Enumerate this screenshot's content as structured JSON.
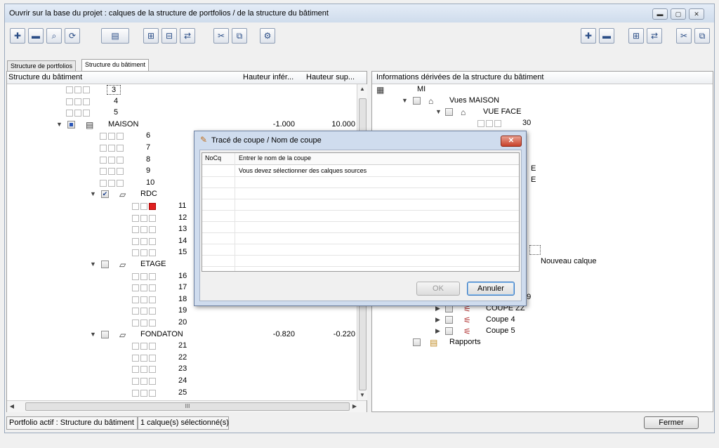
{
  "window": {
    "title": "Ouvrir sur la base du projet : calques de la structure de portfolios / de la structure du bâtiment"
  },
  "tabs": [
    "Structure de portfolios",
    "Structure du bâtiment"
  ],
  "left": {
    "headers": [
      "Structure du bâtiment",
      "Hauteur infér...",
      "Hauteur sup..."
    ],
    "rows": [
      {
        "num": "3"
      },
      {
        "num": "4"
      },
      {
        "num": "5"
      },
      {
        "label": "MAISON",
        "low": "-1.000",
        "high": "10.000"
      },
      {
        "num": "6"
      },
      {
        "num": "7"
      },
      {
        "num": "8"
      },
      {
        "num": "9"
      },
      {
        "num": "10"
      },
      {
        "label": "RDC"
      },
      {
        "num": "11"
      },
      {
        "num": "12"
      },
      {
        "num": "13"
      },
      {
        "num": "14"
      },
      {
        "num": "15"
      },
      {
        "label": "ETAGE"
      },
      {
        "num": "16"
      },
      {
        "num": "17"
      },
      {
        "num": "18"
      },
      {
        "num": "19"
      },
      {
        "num": "20"
      },
      {
        "label": "FONDATON",
        "low": "-0.820",
        "high": "-0.220"
      },
      {
        "num": "21"
      },
      {
        "num": "22"
      },
      {
        "num": "23"
      },
      {
        "num": "24"
      },
      {
        "num": "25"
      }
    ],
    "hscroll_grip": "III"
  },
  "right": {
    "header": "Informations dérivées de la structure du bâtiment",
    "items": {
      "root": "MI",
      "vues": "Vues MAISON",
      "vueface": "VUE FACE",
      "n30": "30",
      "e1": "E",
      "e2": "E",
      "nouveau": "Nouveau calque",
      "n59": "59",
      "coupezz": "COUPE ZZ",
      "coupe4": "Coupe 4",
      "coupe5": "Coupe 5",
      "rapports": "Rapports"
    }
  },
  "status": {
    "portfolio": "Portfolio actif : Structure du bâtiment",
    "selection": "1 calque(s) sélectionné(s)"
  },
  "buttons": {
    "fermer": "Fermer"
  },
  "dialog": {
    "title": "Tracé de coupe / Nom de coupe",
    "col1": "NoCq",
    "col2": "Entrer le nom de la coupe",
    "message": "Vous devez sélectionner des calques sources",
    "ok": "OK",
    "cancel": "Annuler"
  }
}
